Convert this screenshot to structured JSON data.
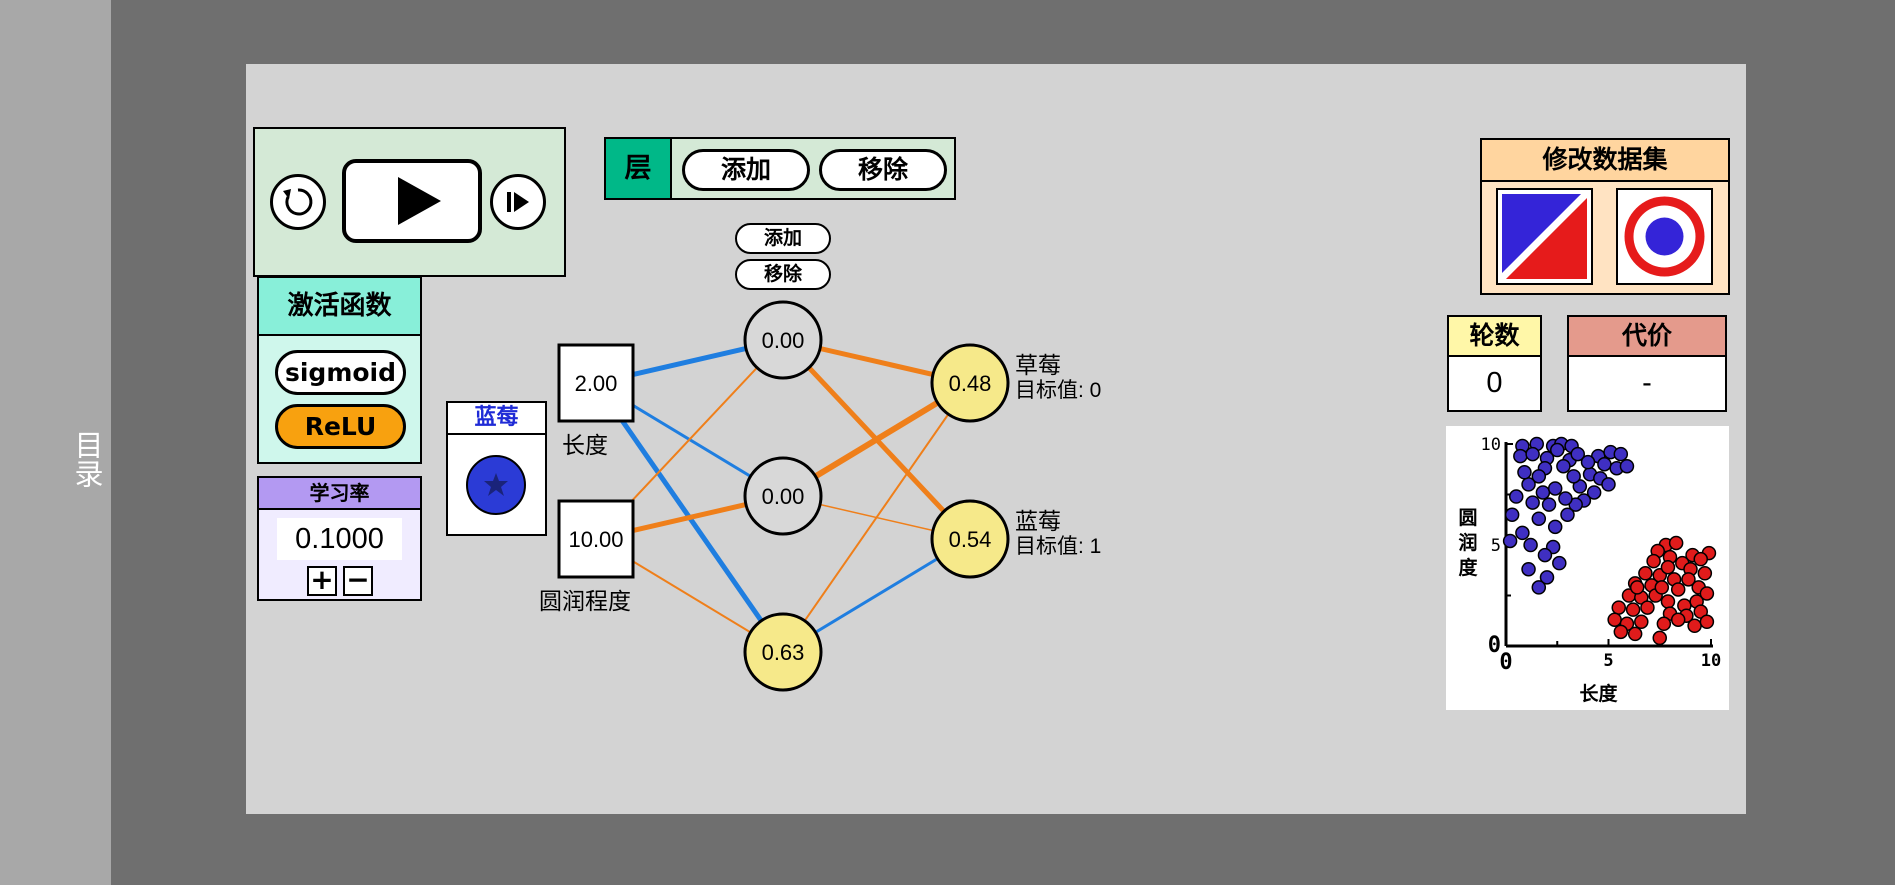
{
  "sidebar": {
    "toc_label": "目录"
  },
  "controls": {
    "reset_icon": "reset-icon",
    "play_icon": "play-icon",
    "step_icon": "step-icon"
  },
  "layer_panel": {
    "title": "层",
    "add_label": "添加",
    "remove_label": "移除"
  },
  "hidden_layer": {
    "add_label": "添加",
    "remove_label": "移除"
  },
  "activation": {
    "title": "激活函数",
    "options": [
      "sigmoid",
      "ReLU"
    ],
    "selected": "ReLU"
  },
  "learning_rate": {
    "title": "学习率",
    "value": "0.1000",
    "plus": "+",
    "minus": "−"
  },
  "sample": {
    "label": "蓝莓",
    "icon": "blueberry-icon"
  },
  "inputs": [
    {
      "value": "2.00",
      "label": "长度"
    },
    {
      "value": "10.00",
      "label": "圆润程度"
    }
  ],
  "hidden_nodes": [
    {
      "value": "0.00"
    },
    {
      "value": "0.00"
    },
    {
      "value": "0.63"
    }
  ],
  "outputs": [
    {
      "value": "0.48",
      "name": "草莓",
      "target": "目标值: 0"
    },
    {
      "value": "0.54",
      "name": "蓝莓",
      "target": "目标值: 1"
    }
  ],
  "dataset_panel": {
    "title": "修改数据集",
    "options": [
      "diagonal-split-icon",
      "ring-target-icon"
    ]
  },
  "epochs": {
    "title": "轮数",
    "value": "0"
  },
  "cost": {
    "title": "代价",
    "value": "-"
  },
  "colors": {
    "positive_weight": "#ef7f1a",
    "negative_weight": "#1f7ee0",
    "neuron_active": "#f6e98a",
    "neuron_inactive": "#d8d8d8",
    "blueberry": "#3f2fc2",
    "strawberry": "#e01b1b"
  },
  "chart_data": {
    "type": "scatter",
    "xlabel": "长度",
    "ylabel": "圆润度",
    "xlim": [
      0,
      10
    ],
    "ylim": [
      0,
      10
    ],
    "x_ticks": [
      "0",
      "5",
      "10"
    ],
    "y_ticks": [
      "0",
      "5",
      "10"
    ],
    "series": [
      {
        "name": "",
        "color": "#3f2fc2",
        "points": [
          [
            0.8,
            9.9
          ],
          [
            1.5,
            10.0
          ],
          [
            2.3,
            9.9
          ],
          [
            2.7,
            10.0
          ],
          [
            3.2,
            9.9
          ],
          [
            0.7,
            9.4
          ],
          [
            1.3,
            9.5
          ],
          [
            2.0,
            9.3
          ],
          [
            2.5,
            9.7
          ],
          [
            3.1,
            9.2
          ],
          [
            4.5,
            9.4
          ],
          [
            5.1,
            9.6
          ],
          [
            5.6,
            9.5
          ],
          [
            4.8,
            9.0
          ],
          [
            5.4,
            8.8
          ],
          [
            5.9,
            8.9
          ],
          [
            4.1,
            8.5
          ],
          [
            4.6,
            8.3
          ],
          [
            5.0,
            8.0
          ],
          [
            3.6,
            7.9
          ],
          [
            4.3,
            7.6
          ],
          [
            3.8,
            7.2
          ],
          [
            3.4,
            7.0
          ],
          [
            1.9,
            8.8
          ],
          [
            1.6,
            8.4
          ],
          [
            1.1,
            8.0
          ],
          [
            1.8,
            7.6
          ],
          [
            2.4,
            7.8
          ],
          [
            0.5,
            7.4
          ],
          [
            1.3,
            7.1
          ],
          [
            2.1,
            7.0
          ],
          [
            0.3,
            6.5
          ],
          [
            1.6,
            6.3
          ],
          [
            2.4,
            5.9
          ],
          [
            3.0,
            6.5
          ],
          [
            0.8,
            5.6
          ],
          [
            0.2,
            5.2
          ],
          [
            1.2,
            5.0
          ],
          [
            2.3,
            4.9
          ],
          [
            1.9,
            4.5
          ],
          [
            2.6,
            4.1
          ],
          [
            1.1,
            3.8
          ],
          [
            2.0,
            3.4
          ],
          [
            1.6,
            2.9
          ],
          [
            0.9,
            8.6
          ],
          [
            2.8,
            8.9
          ],
          [
            3.5,
            9.5
          ],
          [
            4.0,
            9.1
          ],
          [
            2.9,
            7.3
          ],
          [
            3.3,
            8.4
          ]
        ]
      },
      {
        "name": "",
        "color": "#e01b1b",
        "points": [
          [
            7.8,
            5.0
          ],
          [
            8.3,
            5.1
          ],
          [
            7.4,
            4.7
          ],
          [
            8.0,
            4.4
          ],
          [
            9.1,
            4.5
          ],
          [
            9.9,
            4.6
          ],
          [
            7.2,
            4.2
          ],
          [
            8.6,
            4.1
          ],
          [
            9.5,
            4.3
          ],
          [
            6.8,
            3.6
          ],
          [
            7.5,
            3.5
          ],
          [
            8.2,
            3.3
          ],
          [
            9.0,
            3.8
          ],
          [
            9.7,
            3.6
          ],
          [
            6.3,
            3.1
          ],
          [
            7.1,
            3.0
          ],
          [
            8.4,
            2.8
          ],
          [
            9.4,
            2.9
          ],
          [
            6.0,
            2.5
          ],
          [
            6.6,
            2.4
          ],
          [
            7.3,
            2.5
          ],
          [
            7.9,
            2.2
          ],
          [
            8.7,
            2.0
          ],
          [
            9.3,
            2.2
          ],
          [
            5.5,
            1.9
          ],
          [
            6.2,
            1.8
          ],
          [
            6.9,
            1.9
          ],
          [
            8.0,
            1.6
          ],
          [
            8.8,
            1.5
          ],
          [
            9.5,
            1.7
          ],
          [
            5.3,
            1.3
          ],
          [
            5.9,
            1.1
          ],
          [
            6.6,
            1.2
          ],
          [
            7.7,
            1.1
          ],
          [
            8.4,
            1.3
          ],
          [
            9.2,
            1.0
          ],
          [
            9.8,
            1.2
          ],
          [
            5.6,
            0.7
          ],
          [
            6.3,
            0.6
          ],
          [
            7.5,
            0.4
          ],
          [
            7.9,
            3.9
          ],
          [
            8.9,
            3.3
          ],
          [
            6.4,
            2.9
          ],
          [
            7.6,
            2.9
          ],
          [
            9.8,
            2.6
          ]
        ]
      }
    ]
  }
}
